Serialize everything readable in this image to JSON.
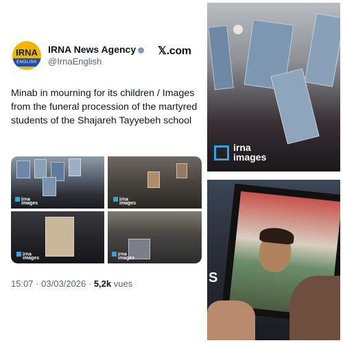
{
  "account": {
    "avatar_line1": "IRNA",
    "avatar_line2": "ENGLISH",
    "name": "IRNA News Agency",
    "handle": "@IrnaEnglish"
  },
  "platform": {
    "logo_text": "𝕏.com"
  },
  "tweet": {
    "text": "Minab in mourning for its children / Images from the funeral procession of the martyred students of the Shajareh Tayyebeh school"
  },
  "watermark": {
    "line1": "irna",
    "line2": "images"
  },
  "meta": {
    "time": "15:07",
    "date": "03/03/2026",
    "views_count": "5,2k",
    "views_label": "vues"
  },
  "right_top_photo": {
    "watermark_line1": "irna",
    "watermark_line2": "images"
  },
  "right_bottom_photo": {
    "edge_letter": "S"
  },
  "colors": {
    "avatar_bg": "#f4b400",
    "avatar_band": "#1f4fa0",
    "text_primary": "#0f1419",
    "text_secondary": "#536471",
    "watermark_accent": "#2fa3e6"
  }
}
